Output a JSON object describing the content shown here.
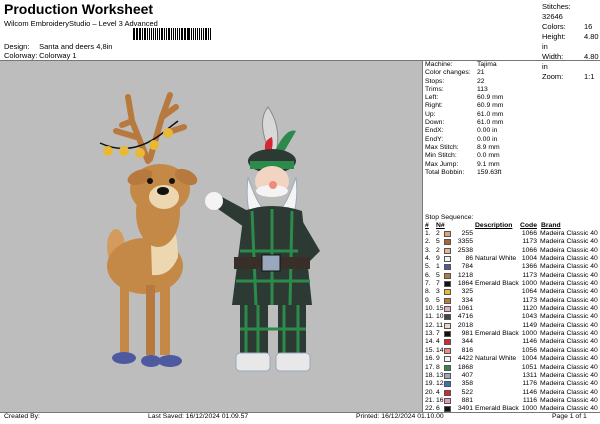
{
  "header": {
    "title": "Production Worksheet",
    "subtitle": "Wilcom EmbroideryStudio – Level 3 Advanced",
    "design_label": "Design:",
    "design_value": "Santa and deers 4,8in",
    "colorway_label": "Colorway:",
    "colorway_value": "Colorway 1"
  },
  "summary": [
    {
      "label": "Stitches:",
      "value": "32646"
    },
    {
      "label": "Colors:",
      "value": "16"
    },
    {
      "label": "Height:",
      "value": "4.80 in"
    },
    {
      "label": "Width:",
      "value": "4.80 in"
    },
    {
      "label": "Zoom:",
      "value": "1:1"
    }
  ],
  "machine_info": [
    {
      "label": "Machine:",
      "value": "Tajima"
    },
    {
      "label": "Color changes:",
      "value": "21"
    },
    {
      "label": "Stops:",
      "value": "22"
    },
    {
      "label": "Trims:",
      "value": "113"
    },
    {
      "label": "Left:",
      "value": "60.9 mm"
    },
    {
      "label": "Right:",
      "value": "60.9 mm"
    },
    {
      "label": "Up:",
      "value": "61.0 mm"
    },
    {
      "label": "Down:",
      "value": "61.0 mm"
    },
    {
      "label": "EndX:",
      "value": "0.00 in"
    },
    {
      "label": "EndY:",
      "value": "0.00 in"
    },
    {
      "label": "Max Stitch:",
      "value": "8.9 mm"
    },
    {
      "label": "Min Stitch:",
      "value": "0.0 mm"
    },
    {
      "label": "Max Jump:",
      "value": "9.1 mm"
    },
    {
      "label": "Total Bobbin:",
      "value": "159.63ft"
    }
  ],
  "stop_sequence": {
    "title": "Stop Sequence:",
    "columns": [
      "#",
      "N#",
      "Description",
      "Code",
      "Brand"
    ],
    "rows": [
      {
        "num": "1.",
        "n": "2",
        "color": "#e0a27a",
        "code": "255",
        "desc": "",
        "code2": "1066",
        "brand": "Madeira Classic 40"
      },
      {
        "num": "2.",
        "n": "5",
        "color": "#a8673a",
        "code": "3355",
        "desc": "",
        "code2": "1173",
        "brand": "Madeira Classic 40"
      },
      {
        "num": "3.",
        "n": "2",
        "color": "#e6b493",
        "code": "2538",
        "desc": "",
        "code2": "1066",
        "brand": "Madeira Classic 40"
      },
      {
        "num": "4.",
        "n": "9",
        "color": "#f4f4f4",
        "code": "86",
        "desc": "Natural White",
        "code2": "1004",
        "brand": "Madeira Classic 40"
      },
      {
        "num": "5.",
        "n": "1",
        "color": "#4e5aa0",
        "code": "784",
        "desc": "",
        "code2": "1366",
        "brand": "Madeira Classic 40"
      },
      {
        "num": "6.",
        "n": "5",
        "color": "#b8793f",
        "code": "1218",
        "desc": "",
        "code2": "1173",
        "brand": "Madeira Classic 40"
      },
      {
        "num": "7.",
        "n": "7",
        "color": "#111111",
        "code": "1864",
        "desc": "Emerald Black",
        "code2": "1000",
        "brand": "Madeira Classic 40"
      },
      {
        "num": "8.",
        "n": "3",
        "color": "#e9b835",
        "code": "325",
        "desc": "",
        "code2": "1064",
        "brand": "Madeira Classic 40"
      },
      {
        "num": "9.",
        "n": "5",
        "color": "#b97a3c",
        "code": "334",
        "desc": "",
        "code2": "1173",
        "brand": "Madeira Classic 40"
      },
      {
        "num": "10.",
        "n": "15",
        "color": "#e9aeb0",
        "code": "1061",
        "desc": "",
        "code2": "1120",
        "brand": "Madeira Classic 40"
      },
      {
        "num": "11.",
        "n": "10",
        "color": "#444444",
        "code": "4716",
        "desc": "",
        "code2": "1043",
        "brand": "Madeira Classic 40"
      },
      {
        "num": "12.",
        "n": "11",
        "color": "#f1d5c2",
        "code": "2018",
        "desc": "",
        "code2": "1149",
        "brand": "Madeira Classic 40"
      },
      {
        "num": "13.",
        "n": "7",
        "color": "#111111",
        "code": "981",
        "desc": "Emerald Black",
        "code2": "1000",
        "brand": "Madeira Classic 40"
      },
      {
        "num": "14.",
        "n": "4",
        "color": "#d8262e",
        "code": "344",
        "desc": "",
        "code2": "1146",
        "brand": "Madeira Classic 40"
      },
      {
        "num": "15.",
        "n": "14",
        "color": "#f08a7c",
        "code": "816",
        "desc": "",
        "code2": "1056",
        "brand": "Madeira Classic 40"
      },
      {
        "num": "16.",
        "n": "9",
        "color": "#f4f4f4",
        "code": "4422",
        "desc": "Natural White",
        "code2": "1004",
        "brand": "Madeira Classic 40"
      },
      {
        "num": "17.",
        "n": "8",
        "color": "#2c8b4a",
        "code": "1868",
        "desc": "",
        "code2": "1051",
        "brand": "Madeira Classic 40"
      },
      {
        "num": "18.",
        "n": "13",
        "color": "#9aa8be",
        "code": "407",
        "desc": "",
        "code2": "1311",
        "brand": "Madeira Classic 40"
      },
      {
        "num": "19.",
        "n": "12",
        "color": "#3e6fb6",
        "code": "358",
        "desc": "",
        "code2": "1176",
        "brand": "Madeira Classic 40"
      },
      {
        "num": "20.",
        "n": "4",
        "color": "#d8262e",
        "code": "522",
        "desc": "",
        "code2": "1146",
        "brand": "Madeira Classic 40"
      },
      {
        "num": "21.",
        "n": "16",
        "color": "#e79aa6",
        "code": "881",
        "desc": "",
        "code2": "1116",
        "brand": "Madeira Classic 40"
      },
      {
        "num": "22.",
        "n": "6",
        "color": "#111111",
        "code": "3491",
        "desc": "Emerald Black",
        "code2": "1000",
        "brand": "Madeira Classic 40"
      }
    ]
  },
  "footer": {
    "created_by": "Created By:",
    "last_saved": "Last Saved: 16/12/2024 01.09.57",
    "printed": "Printed: 16/12/2024 01.10.00",
    "page": "Page 1 of 1"
  }
}
